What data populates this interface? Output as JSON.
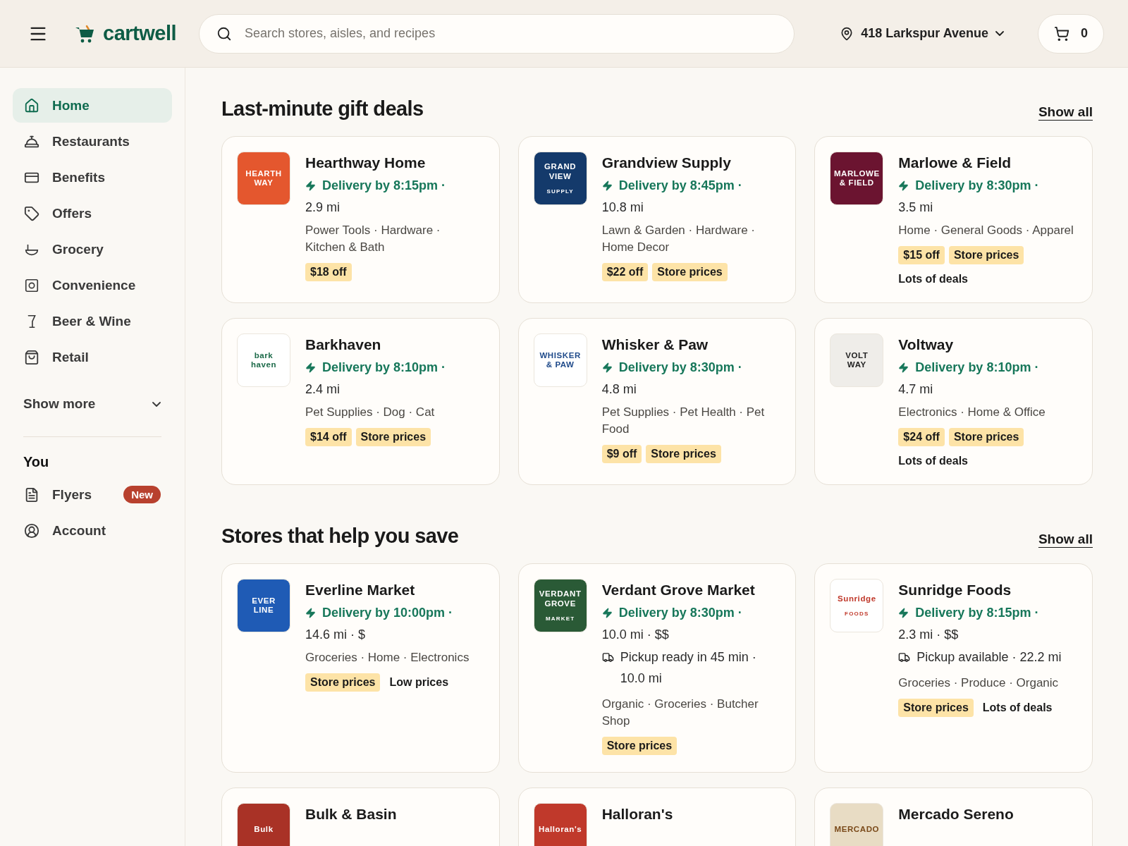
{
  "header": {
    "brand": "cartwell",
    "search": {
      "placeholder": "Search stores, aisles, and recipes"
    },
    "location": "418 Larkspur Avenue",
    "cart_count": "0"
  },
  "sidebar": {
    "items": [
      {
        "label": "Home",
        "selected": true
      },
      {
        "label": "Restaurants",
        "selected": false
      },
      {
        "label": "Benefits",
        "selected": false
      },
      {
        "label": "Offers",
        "selected": false
      },
      {
        "label": "Grocery",
        "selected": false
      },
      {
        "label": "Convenience",
        "selected": false
      },
      {
        "label": "Beer & Wine",
        "selected": false
      },
      {
        "label": "Retail",
        "selected": false
      }
    ],
    "show_more": "Show more",
    "you": {
      "heading": "You",
      "items": [
        {
          "label": "Flyers",
          "badge": "New",
          "selected": false
        },
        {
          "label": "Account",
          "selected": false
        }
      ]
    }
  },
  "sections": [
    {
      "title": "Last-minute gift deals",
      "show_all": "Show all",
      "stores": [
        {
          "name": "Hearthway Home",
          "logo": {
            "color": "#e4572e",
            "text": {
              "lines": [
                "HEARTH",
                "WAY"
              ],
              "color": "#ffffff"
            }
          },
          "delivery": "Delivery by 8:15pm ·",
          "distance": "2.9 mi",
          "categories": "Power Tools · Hardware · Kitchen & Bath",
          "tags": [
            {
              "label": "$18 off",
              "highlight": true
            }
          ]
        },
        {
          "name": "Grandview Supply",
          "logo": {
            "color": "#143a6b",
            "text": {
              "lines": [
                "GRAND",
                "VIEW"
              ],
              "sub": "SUPPLY",
              "color": "#ffffff"
            }
          },
          "delivery": "Delivery by 8:45pm ·",
          "distance": "10.8 mi",
          "categories": "Lawn & Garden · Hardware · Home Decor",
          "tags": [
            {
              "label": "$22 off",
              "highlight": true
            },
            {
              "label": "Store prices",
              "highlight": true
            }
          ]
        },
        {
          "name": "Marlowe & Field",
          "logo": {
            "color": "#6b1430",
            "text": {
              "lines": [
                "MARLOWE",
                "& FIELD"
              ],
              "color": "#ffffff"
            }
          },
          "delivery": "Delivery by 8:30pm ·",
          "distance": "3.5 mi",
          "categories": "Home · General Goods · Apparel",
          "tags": [
            {
              "label": "$15 off",
              "highlight": true
            },
            {
              "label": "Store prices",
              "highlight": true
            }
          ],
          "note": "Lots of deals"
        },
        {
          "name": "Barkhaven",
          "logo": {
            "color": "#ffffff",
            "text": {
              "lines": [
                "bark",
                "haven"
              ],
              "color": "#1d6b4a"
            }
          },
          "delivery": "Delivery by 8:10pm ·",
          "distance": "2.4 mi",
          "categories": "Pet Supplies · Dog · Cat",
          "tags": [
            {
              "label": "$14 off",
              "highlight": true
            },
            {
              "label": "Store prices",
              "highlight": true
            }
          ]
        },
        {
          "name": "Whisker & Paw",
          "logo": {
            "color": "#ffffff",
            "text": {
              "lines": [
                "WHISKER",
                "& PAW"
              ],
              "color": "#1f4a8a"
            }
          },
          "delivery": "Delivery by 8:30pm ·",
          "distance": "4.8 mi",
          "categories": "Pet Supplies · Pet Health · Pet Food",
          "tags": [
            {
              "label": "$9 off",
              "highlight": true
            },
            {
              "label": "Store prices",
              "highlight": true
            }
          ]
        },
        {
          "name": "Voltway",
          "logo": {
            "color": "#efede9",
            "text": {
              "lines": [
                "VOLT",
                "WAY"
              ],
              "color": "#222222"
            }
          },
          "delivery": "Delivery by 8:10pm ·",
          "distance": "4.7 mi",
          "categories": "Electronics · Home & Office",
          "tags": [
            {
              "label": "$24 off",
              "highlight": true
            },
            {
              "label": "Store prices",
              "highlight": true
            }
          ],
          "note": "Lots of deals"
        }
      ]
    },
    {
      "title": "Stores that help you save",
      "show_all": "Show all",
      "stores": [
        {
          "name": "Everline Market",
          "logo": {
            "color": "#1f5bb5",
            "text": {
              "lines": [
                "EVER",
                "LINE"
              ],
              "color": "#ffffff"
            }
          },
          "delivery": "Delivery by 10:00pm ·",
          "distance": "14.6 mi · $",
          "categories": "Groceries · Home · Electronics",
          "tags": [
            {
              "label": "Store prices",
              "highlight": true
            },
            {
              "label": "Low prices",
              "highlight": false
            }
          ]
        },
        {
          "name": "Verdant Grove Market",
          "logo": {
            "color": "#2a5a36",
            "text": {
              "lines": [
                "VERDANT",
                "GROVE"
              ],
              "sub": "MARKET",
              "color": "#ffffff"
            }
          },
          "delivery": "Delivery by 8:30pm ·",
          "distance": "10.0 mi · $$",
          "pickup": "Pickup ready in 45 min · 10.0 mi",
          "categories": "Organic · Groceries · Butcher Shop",
          "tags": [
            {
              "label": "Store prices",
              "highlight": true
            }
          ]
        },
        {
          "name": "Sunridge Foods",
          "logo": {
            "color": "#ffffff",
            "text": {
              "lines": [
                "Sunridge"
              ],
              "sub": "FOODS",
              "color": "#c0392b"
            }
          },
          "delivery": "Delivery by 8:15pm ·",
          "distance": "2.3 mi · $$",
          "pickup": "Pickup available · 22.2 mi",
          "categories": "Groceries · Produce · Organic",
          "tags": [
            {
              "label": "Store prices",
              "highlight": true
            },
            {
              "label": "Lots of deals",
              "highlight": false
            }
          ]
        },
        {
          "name": "Bulk & Basin",
          "logo": {
            "color": "#a93226",
            "text": {
              "lines": [
                "Bulk"
              ],
              "color": "#ffffff"
            }
          }
        },
        {
          "name": "Halloran's",
          "logo": {
            "color": "#c0392b",
            "text": {
              "lines": [
                "Halloran's"
              ],
              "color": "#ffffff"
            }
          }
        },
        {
          "name": "Mercado Sereno",
          "logo": {
            "color": "#e8dcc4",
            "text": {
              "lines": [
                "MERCADO"
              ],
              "color": "#7a4a1a"
            }
          }
        }
      ]
    }
  ]
}
